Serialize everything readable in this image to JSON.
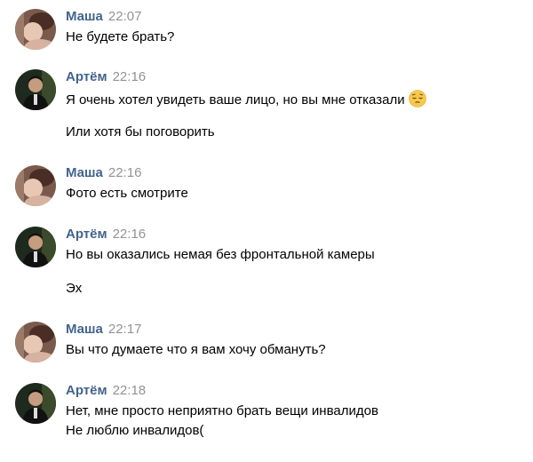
{
  "messages": [
    {
      "author": "Маша",
      "time": "22:07",
      "avatar_icon": "masha-avatar",
      "lines": [
        "Не будете брать?"
      ]
    },
    {
      "author": "Артём",
      "time": "22:16",
      "avatar_icon": "artem-avatar",
      "lines": [
        "Я очень хотел увидеть ваше лицо, но вы мне отказали",
        "Или хотя бы поговорить"
      ],
      "emoji_icon": "pensive-face-emoji"
    },
    {
      "author": "Маша",
      "time": "22:16",
      "avatar_icon": "masha-avatar",
      "lines": [
        "Фото есть смотрите"
      ]
    },
    {
      "author": "Артём",
      "time": "22:16",
      "avatar_icon": "artem-avatar",
      "lines": [
        "Но вы оказались немая без фронтальной камеры",
        "Эх"
      ]
    },
    {
      "author": "Маша",
      "time": "22:17",
      "avatar_icon": "masha-avatar",
      "lines": [
        "Вы что думаете что я вам хочу обмануть?"
      ]
    },
    {
      "author": "Артём",
      "time": "22:18",
      "avatar_icon": "artem-avatar",
      "lines": [
        "Нет, мне просто неприятно брать вещи инвалидов",
        "Не люблю инвалидов("
      ]
    }
  ],
  "colors": {
    "author": "#42648b",
    "time": "#939393",
    "text": "#000000",
    "background": "#ffffff"
  }
}
